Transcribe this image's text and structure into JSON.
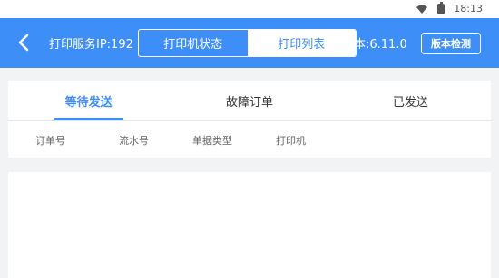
{
  "status_bar": {
    "time": "18:13",
    "icons": [
      "wifi-icon",
      "battery-icon"
    ]
  },
  "header": {
    "server_label": "打印服务IP:192",
    "version_label": "本:6.11.0",
    "segments": [
      "打印机状态",
      "打印列表"
    ],
    "active_segment": "打印列表",
    "check_button": "版本检测",
    "accent_color": "#3e8ef7"
  },
  "tabs": [
    {
      "label": "等待发送",
      "active": true
    },
    {
      "label": "故障订单",
      "active": false
    },
    {
      "label": "已发送",
      "active": false
    }
  ],
  "columns": [
    "订单号",
    "流水号",
    "单据类型",
    "打印机"
  ],
  "rows": []
}
